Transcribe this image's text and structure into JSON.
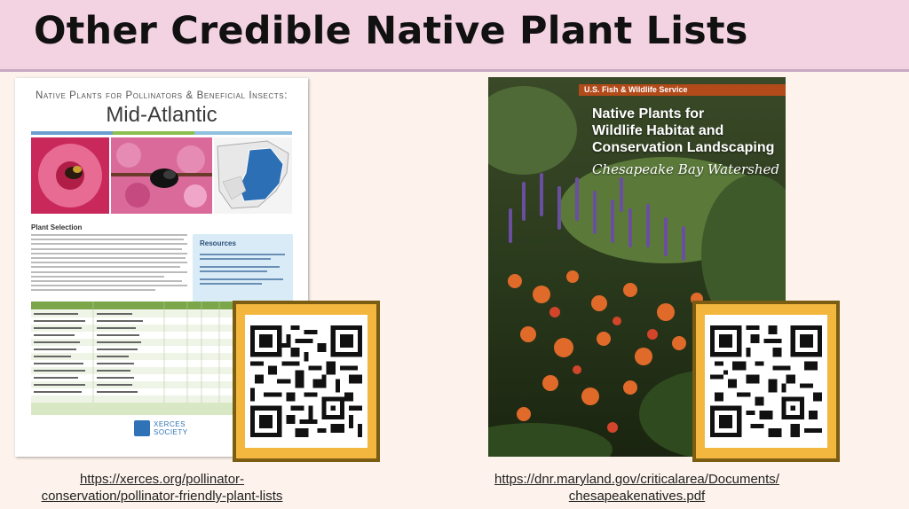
{
  "title": "Other Credible Native Plant Lists",
  "left_doc": {
    "heading": "Native Plants for Pollinators & Beneficial Insects:",
    "region": "Mid-Atlantic",
    "section_heading": "Plant Selection",
    "resources_heading": "Resources",
    "logo_text": "XERCES SOCIETY"
  },
  "right_doc": {
    "agency": "U.S. Fish & Wildlife Service",
    "title_line1": "Native Plants for",
    "title_line2": "Wildlife Habitat and",
    "title_line3": "Conservation Landscaping",
    "subtitle": "Chesapeake Bay Watershed"
  },
  "links": {
    "left_line1": "https://xerces.org/pollinator-",
    "left_line2": "conservation/pollinator-friendly-plant-lists",
    "right_line1": "https://dnr.maryland.gov/criticalarea/Documents/",
    "right_line2": "chesapeakenatives.pdf"
  },
  "colors": {
    "title_bar": "#f3d2e1",
    "background": "#fdf3ec",
    "qr_frame": "#f3b73f",
    "qr_border": "#7a5c12"
  }
}
